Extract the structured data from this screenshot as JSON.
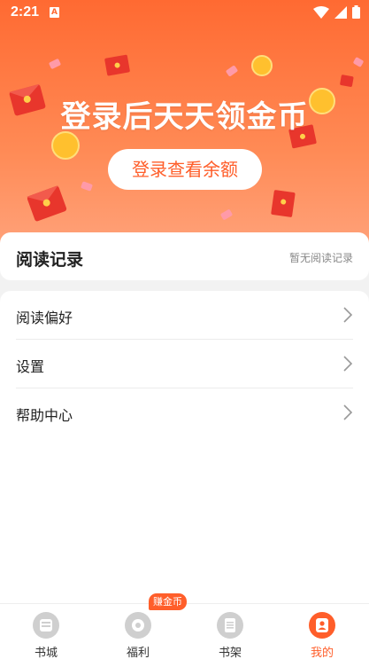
{
  "status_bar": {
    "time": "2:21",
    "input_indicator": "A"
  },
  "hero": {
    "title": "登录后天天领金币",
    "login_button": "登录查看余额"
  },
  "reading_history": {
    "title": "阅读记录",
    "empty_text": "暂无阅读记录"
  },
  "menu": {
    "items": [
      {
        "label": "阅读偏好"
      },
      {
        "label": "设置"
      },
      {
        "label": "帮助中心"
      }
    ]
  },
  "tabbar": {
    "badge": "赚金币",
    "tabs": [
      {
        "label": "书城",
        "icon": "bookstore-icon"
      },
      {
        "label": "福利",
        "icon": "welfare-icon"
      },
      {
        "label": "书架",
        "icon": "bookshelf-icon"
      },
      {
        "label": "我的",
        "icon": "profile-icon"
      }
    ]
  },
  "colors": {
    "accent": "#ff5e2a",
    "hero_top": "#ff6a32",
    "hero_bottom": "#ffa27a"
  }
}
